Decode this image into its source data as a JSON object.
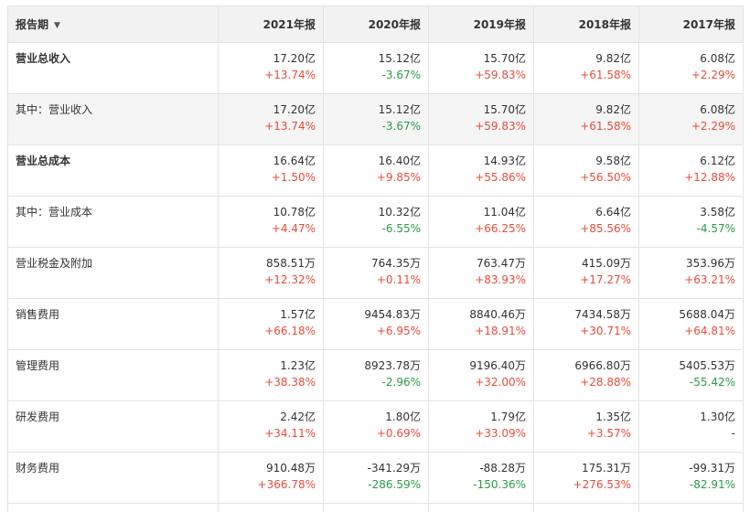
{
  "header": {
    "label": "报告期",
    "caret": "▼",
    "years": [
      "2021年报",
      "2020年报",
      "2019年报",
      "2018年报",
      "2017年报"
    ]
  },
  "rows": [
    {
      "label": "营业总收入",
      "bold": true,
      "shade": false,
      "cells": [
        {
          "value": "17.20亿",
          "change": "+13.74%",
          "trend": "up"
        },
        {
          "value": "15.12亿",
          "change": "-3.67%",
          "trend": "down"
        },
        {
          "value": "15.70亿",
          "change": "+59.83%",
          "trend": "up"
        },
        {
          "value": "9.82亿",
          "change": "+61.58%",
          "trend": "up"
        },
        {
          "value": "6.08亿",
          "change": "+2.29%",
          "trend": "up"
        }
      ]
    },
    {
      "label": "其中：营业收入",
      "bold": false,
      "shade": true,
      "cells": [
        {
          "value": "17.20亿",
          "change": "+13.74%",
          "trend": "up"
        },
        {
          "value": "15.12亿",
          "change": "-3.67%",
          "trend": "down"
        },
        {
          "value": "15.70亿",
          "change": "+59.83%",
          "trend": "up"
        },
        {
          "value": "9.82亿",
          "change": "+61.58%",
          "trend": "up"
        },
        {
          "value": "6.08亿",
          "change": "+2.29%",
          "trend": "up"
        }
      ]
    },
    {
      "label": "营业总成本",
      "bold": true,
      "shade": false,
      "cells": [
        {
          "value": "16.64亿",
          "change": "+1.50%",
          "trend": "up"
        },
        {
          "value": "16.40亿",
          "change": "+9.85%",
          "trend": "up"
        },
        {
          "value": "14.93亿",
          "change": "+55.86%",
          "trend": "up"
        },
        {
          "value": "9.58亿",
          "change": "+56.50%",
          "trend": "up"
        },
        {
          "value": "6.12亿",
          "change": "+12.88%",
          "trend": "up"
        }
      ]
    },
    {
      "label": "其中：营业成本",
      "bold": false,
      "shade": false,
      "cells": [
        {
          "value": "10.78亿",
          "change": "+4.47%",
          "trend": "up"
        },
        {
          "value": "10.32亿",
          "change": "-6.55%",
          "trend": "down"
        },
        {
          "value": "11.04亿",
          "change": "+66.25%",
          "trend": "up"
        },
        {
          "value": "6.64亿",
          "change": "+85.56%",
          "trend": "up"
        },
        {
          "value": "3.58亿",
          "change": "-4.57%",
          "trend": "down"
        }
      ]
    },
    {
      "label": "营业税金及附加",
      "bold": false,
      "shade": false,
      "cells": [
        {
          "value": "858.51万",
          "change": "+12.32%",
          "trend": "up"
        },
        {
          "value": "764.35万",
          "change": "+0.11%",
          "trend": "up"
        },
        {
          "value": "763.47万",
          "change": "+83.93%",
          "trend": "up"
        },
        {
          "value": "415.09万",
          "change": "+17.27%",
          "trend": "up"
        },
        {
          "value": "353.96万",
          "change": "+63.21%",
          "trend": "up"
        }
      ]
    },
    {
      "label": "销售费用",
      "bold": false,
      "shade": false,
      "cells": [
        {
          "value": "1.57亿",
          "change": "+66.18%",
          "trend": "up"
        },
        {
          "value": "9454.83万",
          "change": "+6.95%",
          "trend": "up"
        },
        {
          "value": "8840.46万",
          "change": "+18.91%",
          "trend": "up"
        },
        {
          "value": "7434.58万",
          "change": "+30.71%",
          "trend": "up"
        },
        {
          "value": "5688.04万",
          "change": "+64.81%",
          "trend": "up"
        }
      ]
    },
    {
      "label": "管理费用",
      "bold": false,
      "shade": false,
      "cells": [
        {
          "value": "1.23亿",
          "change": "+38.38%",
          "trend": "up"
        },
        {
          "value": "8923.78万",
          "change": "-2.96%",
          "trend": "down"
        },
        {
          "value": "9196.40万",
          "change": "+32.00%",
          "trend": "up"
        },
        {
          "value": "6966.80万",
          "change": "+28.88%",
          "trend": "up"
        },
        {
          "value": "5405.53万",
          "change": "-55.42%",
          "trend": "down"
        }
      ]
    },
    {
      "label": "研发费用",
      "bold": false,
      "shade": false,
      "cells": [
        {
          "value": "2.42亿",
          "change": "+34.11%",
          "trend": "up"
        },
        {
          "value": "1.80亿",
          "change": "+0.69%",
          "trend": "up"
        },
        {
          "value": "1.79亿",
          "change": "+33.09%",
          "trend": "up"
        },
        {
          "value": "1.35亿",
          "change": "+3.57%",
          "trend": "up"
        },
        {
          "value": "1.30亿",
          "change": "-",
          "trend": "flat"
        }
      ]
    },
    {
      "label": "财务费用",
      "bold": false,
      "shade": false,
      "cells": [
        {
          "value": "910.48万",
          "change": "+366.78%",
          "trend": "up"
        },
        {
          "value": "-341.29万",
          "change": "-286.59%",
          "trend": "down"
        },
        {
          "value": "-88.28万",
          "change": "-150.36%",
          "trend": "down"
        },
        {
          "value": "175.31万",
          "change": "+276.53%",
          "trend": "up"
        },
        {
          "value": "-99.31万",
          "change": "-82.91%",
          "trend": "down"
        }
      ]
    }
  ],
  "colors": {
    "up": "#e74c3c",
    "down": "#2a9d45",
    "header_bg": "#f2f2f2",
    "shade_bg": "#f5f5f5",
    "border": "#e3e3e3"
  }
}
